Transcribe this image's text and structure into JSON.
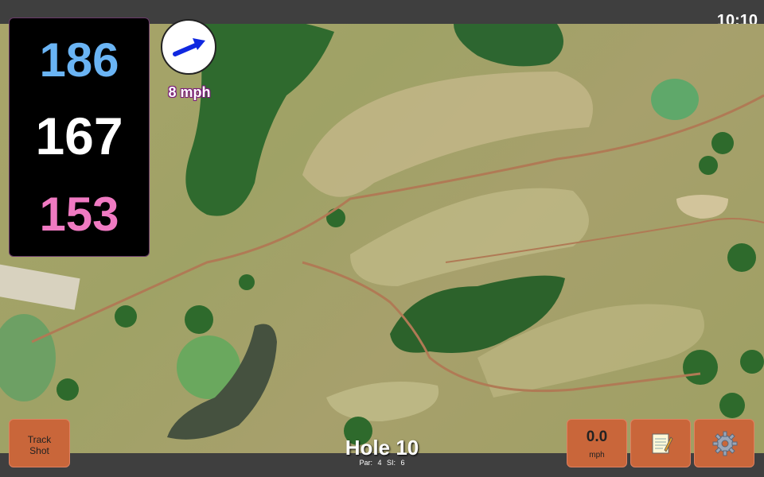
{
  "status": {
    "time": "10:10"
  },
  "distances": {
    "back": "186",
    "middle": "167",
    "front": "153"
  },
  "wind": {
    "speed": "8 mph",
    "direction_icon": "wind-arrow-icon"
  },
  "hole": {
    "title": "Hole 10",
    "par_label": "Par: 4",
    "si_label": "SI: 6"
  },
  "buttons": {
    "track_shot": {
      "line1": "Track",
      "line2": "Shot"
    },
    "speed": {
      "value": "0.0",
      "unit": "mph"
    },
    "notes_icon": "notepad-icon",
    "settings_icon": "gear-icon"
  },
  "colors": {
    "back_distance": "#6ab4f4",
    "middle_distance": "#ffffff",
    "front_distance": "#f07ac2",
    "button": "#c9663a"
  }
}
